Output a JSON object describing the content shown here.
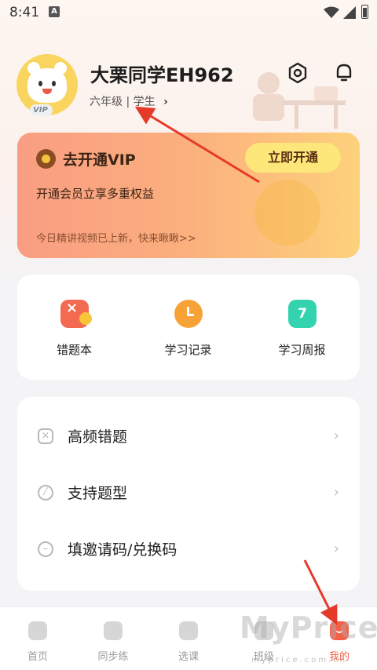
{
  "status_bar": {
    "time": "8:41",
    "notification_glyph": "A"
  },
  "profile": {
    "name": "大栗同学EH962",
    "grade": "六年级",
    "separator": "|",
    "role": "学生",
    "vip_badge": "VIP"
  },
  "vip_card": {
    "title": "去开通VIP",
    "button": "立即开通",
    "description": "开通会员立享多重权益",
    "note": "今日精讲视频已上新，快来瞅瞅>>"
  },
  "tools": [
    {
      "label": "错题本",
      "icon": "wrong-book-icon"
    },
    {
      "label": "学习记录",
      "icon": "clock-icon"
    },
    {
      "label": "学习周报",
      "icon": "weekly-report-icon",
      "glyph": "7"
    }
  ],
  "menu": [
    {
      "label": "高频错题",
      "icon": "error-icon"
    },
    {
      "label": "支持题型",
      "icon": "tag-icon"
    },
    {
      "label": "填邀请码/兑换码",
      "icon": "code-icon"
    }
  ],
  "bottom_nav": [
    {
      "label": "首页",
      "active": false
    },
    {
      "label": "同步练",
      "active": false
    },
    {
      "label": "选课",
      "active": false
    },
    {
      "label": "班级",
      "active": false
    },
    {
      "label": "我的",
      "active": true
    }
  ],
  "watermark": {
    "main": "MyPrice",
    "sub": "myprice.com.cn"
  },
  "colors": {
    "accent": "#f4614a",
    "vip_gradient_start": "#f99d82",
    "vip_gradient_end": "#fdd17c",
    "annotation": "#e53a2a"
  }
}
